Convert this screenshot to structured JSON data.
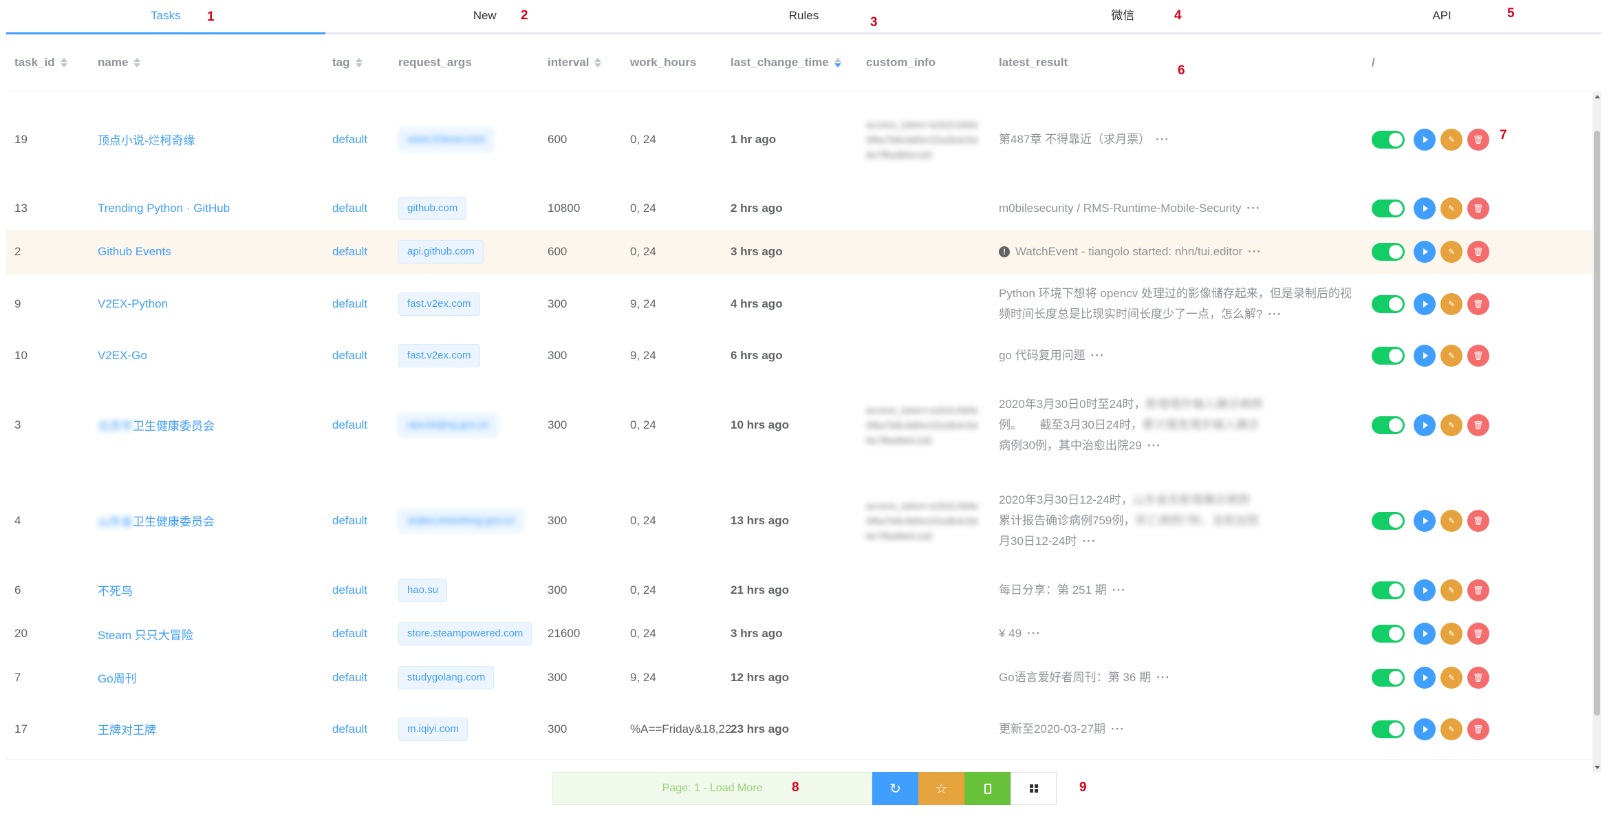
{
  "tabs": [
    {
      "label": "Tasks",
      "active": true,
      "badge": "1"
    },
    {
      "label": "New",
      "badge": "2"
    },
    {
      "label": "Rules",
      "badge": "3"
    },
    {
      "label": "微信",
      "badge": "4"
    },
    {
      "label": "API",
      "badge": "5"
    }
  ],
  "annotations": {
    "header": "6",
    "actions": "7",
    "loadmore": "8",
    "buttons": "9"
  },
  "columns": {
    "task_id": "task_id",
    "name": "name",
    "tag": "tag",
    "request_args": "request_args",
    "interval": "interval",
    "work_hours": "work_hours",
    "last_change_time": "last_change_time",
    "custom_info": "custom_info",
    "latest_result": "latest_result",
    "actions": "/"
  },
  "rows": [
    {
      "id": "19",
      "name": "顶点小说-烂柯奇缘",
      "tag": "default",
      "req": "www.23wxw.com",
      "interval": "600",
      "work_hours": "0, 24",
      "last_change": "1 hr ago",
      "custom_info": "access_token=a1b2c3d4e5f6a7b8c9d0e1f2a3b4c5d6e7f8a9b0c1d2",
      "result": "第487章 不得靠近（求月票）"
    },
    {
      "id": "13",
      "name": "Trending Python · GitHub",
      "tag": "default",
      "req": "github.com",
      "interval": "10800",
      "work_hours": "0, 24",
      "last_change": "2 hrs ago",
      "custom_info": "",
      "result": "m0bilesecurity / RMS-Runtime-Mobile-Security"
    },
    {
      "id": "2",
      "name": "Github Events",
      "tag": "default",
      "req": "api.github.com",
      "interval": "600",
      "work_hours": "0, 24",
      "last_change": "3 hrs ago",
      "custom_info": "",
      "result": "WatchEvent - tiangolo started: nhn/tui.editor",
      "warning": "!"
    },
    {
      "id": "9",
      "name": "V2EX-Python",
      "tag": "default",
      "req": "fast.v2ex.com",
      "interval": "300",
      "work_hours": "9, 24",
      "last_change": "4 hrs ago",
      "custom_info": "",
      "result": "Python 环境下想将 opencv 处理过的影像储存起来，但是录制后的视频时间长度总是比现实时间长度少了一点，怎么解?"
    },
    {
      "id": "10",
      "name": "V2EX-Go",
      "tag": "default",
      "req": "fast.v2ex.com",
      "interval": "300",
      "work_hours": "9, 24",
      "last_change": "6 hrs ago",
      "custom_info": "",
      "result": "go 代码复用问题"
    },
    {
      "id": "3",
      "name_blur": "北京市",
      "name": "卫生健康委员会",
      "tag": "default",
      "req": "wjw.beijing.gov.cn",
      "interval": "300",
      "work_hours": "0, 24",
      "last_change": "10 hrs ago",
      "custom_info": "access_token=a1b2c3d4e5f6a7b8c9d0e1f2a3b4c5d6e7f8a9b0c1d2",
      "result_a": "2020年3月30日0时至24时，",
      "result_blur_a": "新增境外输入确诊病例",
      "result_b": "例。　　截至3月30日24时，",
      "result_blur_b": "累计报告境外输入确诊",
      "result_c": "病例30例，其中治愈出院29"
    },
    {
      "id": "4",
      "name_blur": "山东省",
      "name": "卫生健康委员会",
      "tag": "default",
      "req": "wsjkw.shandong.gov.cn",
      "interval": "300",
      "work_hours": "0, 24",
      "last_change": "13 hrs ago",
      "custom_info": "access_token=a1b2c3d4e5f6a7b8c9d0e1f2a3b4c5d6e7f8a9b0c1d2",
      "result_a": "2020年3月30日12-24时，",
      "result_blur_a": "山东省无新增确诊病例",
      "result_b": "累计报告确诊病例759例，",
      "result_blur_b": "死亡病例7例，治愈出院",
      "result_c": "月30日12-24时"
    },
    {
      "id": "6",
      "name": "不死鸟",
      "tag": "default",
      "req": "hao.su",
      "interval": "300",
      "work_hours": "0, 24",
      "last_change": "21 hrs ago",
      "custom_info": "",
      "result": "每日分享：第 251 期"
    },
    {
      "id": "20",
      "name": "Steam 只只大冒险",
      "tag": "default",
      "req": "store.steampowered.com",
      "interval": "21600",
      "work_hours": "0, 24",
      "last_change": "3 hrs ago",
      "custom_info": "",
      "result": "¥ 49"
    },
    {
      "id": "7",
      "name": "Go周刊",
      "tag": "default",
      "req": "studygolang.com",
      "interval": "300",
      "work_hours": "9, 24",
      "last_change": "12 hrs ago",
      "custom_info": "",
      "result": "Go语言爱好者周刊：第 36 期"
    },
    {
      "id": "17",
      "name": "王牌对王牌",
      "tag": "default",
      "req": "m.iqiyi.com",
      "interval": "300",
      "work_hours": "%A==Friday&18,22",
      "last_change": "23 hrs ago",
      "custom_info": "",
      "result": "更新至2020-03-27期"
    }
  ],
  "more_glyph": "···",
  "footer": {
    "load_more": "Page: 1 - Load More",
    "refresh_glyph": "↻",
    "star_glyph": "☆"
  },
  "colors": {
    "primary": "#409eff",
    "success": "#13ce66",
    "warning": "#e6a23c",
    "danger": "#f56c6c",
    "highlight_row": "#fdf6ec"
  }
}
